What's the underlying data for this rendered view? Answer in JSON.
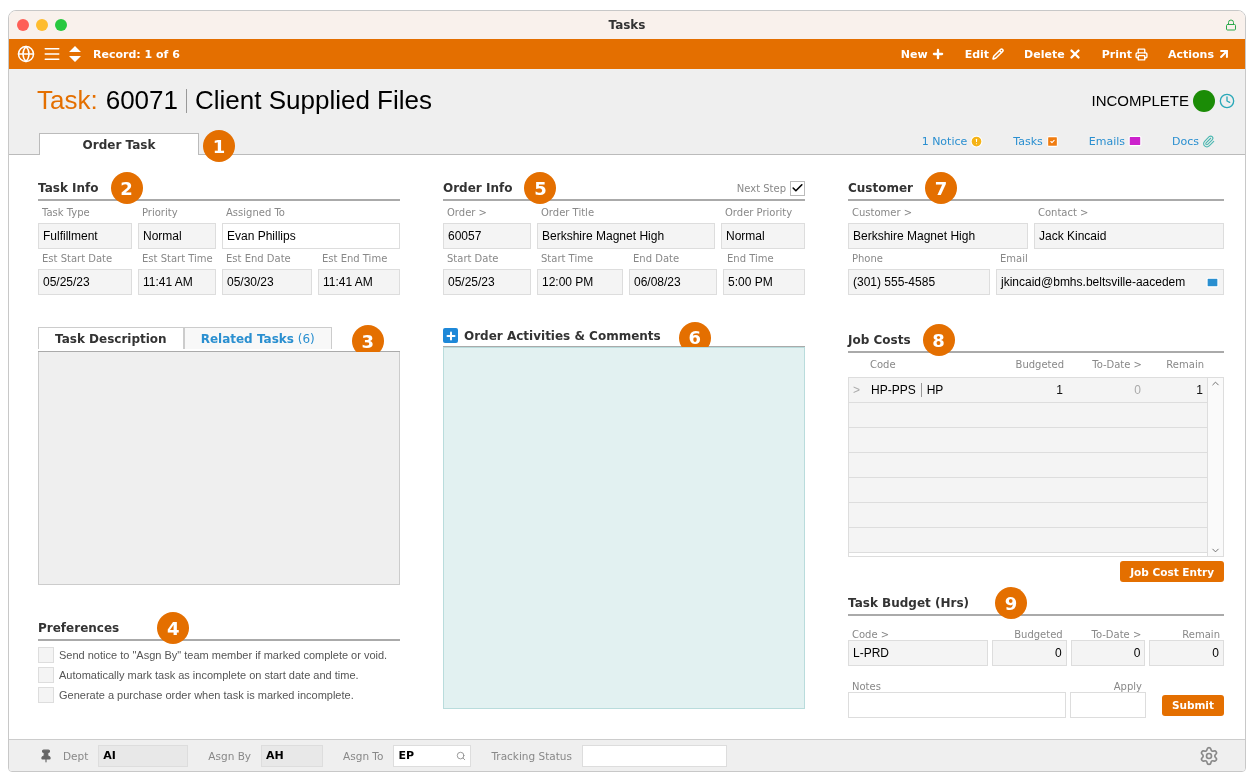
{
  "window": {
    "title": "Tasks"
  },
  "toolbar": {
    "record": "Record: 1 of 6",
    "actions": [
      {
        "label": "New",
        "kind": "new"
      },
      {
        "label": "Edit",
        "kind": "edit"
      },
      {
        "label": "Delete",
        "kind": "delete"
      },
      {
        "label": "Print",
        "kind": "print"
      },
      {
        "label": "Actions",
        "kind": "actions"
      }
    ]
  },
  "header": {
    "prefix": "Task:",
    "number": "60071",
    "title": "Client Supplied Files",
    "status": "INCOMPLETE"
  },
  "tabs": [
    {
      "label": "Order Task",
      "selected": true
    }
  ],
  "tab_callout": "1",
  "links": [
    {
      "label": "1 Notice",
      "kind": "notice"
    },
    {
      "label": "Tasks",
      "kind": "tasks"
    },
    {
      "label": "Emails",
      "kind": "emails"
    },
    {
      "label": "Docs",
      "kind": "docs"
    }
  ],
  "task_info": {
    "title": "Task Info",
    "callout": "2",
    "rows": [
      {
        "fields": [
          {
            "label": "Task Type",
            "value": "Fulfillment"
          },
          {
            "label": "Priority",
            "value": "Normal"
          },
          {
            "label": "Assigned To",
            "value": "Evan Phillips",
            "kind": "editable"
          }
        ]
      },
      {
        "fields": [
          {
            "label": "Est Start Date",
            "value": "05/25/23"
          },
          {
            "label": "Est Start Time",
            "value": "11:41 AM"
          },
          {
            "label": "Est End Date",
            "value": "05/30/23"
          },
          {
            "label": "Est End Time",
            "value": "11:41 AM"
          }
        ]
      }
    ]
  },
  "description": {
    "callout": "3",
    "tabs": [
      {
        "label": "Task Description",
        "selected": true
      },
      {
        "label": "Related Tasks",
        "count": "(6)",
        "selected": false
      }
    ]
  },
  "preferences": {
    "title": "Preferences",
    "callout": "4",
    "options": [
      {
        "label": "Send notice to \"Asgn By\" team member if marked complete or void.",
        "checked": false
      },
      {
        "label": "Automatically mark task as incomplete on start date and time.",
        "checked": false
      },
      {
        "label": "Generate a purchase order when task is marked incomplete.",
        "checked": false
      }
    ]
  },
  "order_info": {
    "title": "Order Info",
    "callout": "5",
    "next_step": {
      "label": "Next Step",
      "checked": true
    },
    "rows": [
      {
        "fields": [
          {
            "label": "Order >",
            "value": "60057"
          },
          {
            "label": "Order Title",
            "value": "Berkshire Magnet High"
          },
          {
            "label": "Order Priority",
            "value": "Normal"
          }
        ]
      },
      {
        "fields": [
          {
            "label": "Start Date",
            "value": "05/25/23"
          },
          {
            "label": "Start Time",
            "value": "12:00 PM"
          },
          {
            "label": "End Date",
            "value": "06/08/23"
          },
          {
            "label": "End Time",
            "value": "5:00 PM"
          }
        ]
      }
    ]
  },
  "activities": {
    "title": "Order Activities & Comments",
    "callout": "6"
  },
  "customer": {
    "title": "Customer",
    "callout": "7",
    "rows": [
      {
        "fields": [
          {
            "label": "Customer >",
            "value": "Berkshire Magnet High"
          },
          {
            "label": "Contact >",
            "value": "Jack Kincaid"
          }
        ]
      },
      {
        "fields": [
          {
            "label": "Phone",
            "value": "(301) 555-4585"
          },
          {
            "label": "Email",
            "value": "jkincaid@bmhs.beltsville-aacedem",
            "kind": "email"
          }
        ]
      }
    ]
  },
  "job_costs": {
    "title": "Job Costs",
    "callout": "8",
    "columns": [
      "Code",
      "Budgeted",
      "To-Date >",
      "Remain"
    ],
    "rows": [
      {
        "arrow": ">",
        "code": "HP-PPS",
        "unit": "HP",
        "budgeted": "1",
        "to_date": "0",
        "remain": "1"
      }
    ],
    "button": "Job Cost Entry"
  },
  "task_budget": {
    "title": "Task Budget (Hrs)",
    "callout": "9",
    "columns": [
      "Code >",
      "Budgeted",
      "To-Date >",
      "Remain"
    ],
    "values": [
      "L-PRD",
      "0",
      "0",
      "0"
    ],
    "notes_label": "Notes",
    "apply_label": "Apply",
    "button": "Submit"
  },
  "status_bar": {
    "fields": [
      {
        "label": "Dept",
        "value": "AI"
      },
      {
        "label": "Asgn By",
        "value": "AH"
      },
      {
        "label": "Asgn To",
        "value": "EP",
        "kind": "search"
      },
      {
        "label": "Tracking Status",
        "kind": "white"
      }
    ]
  }
}
